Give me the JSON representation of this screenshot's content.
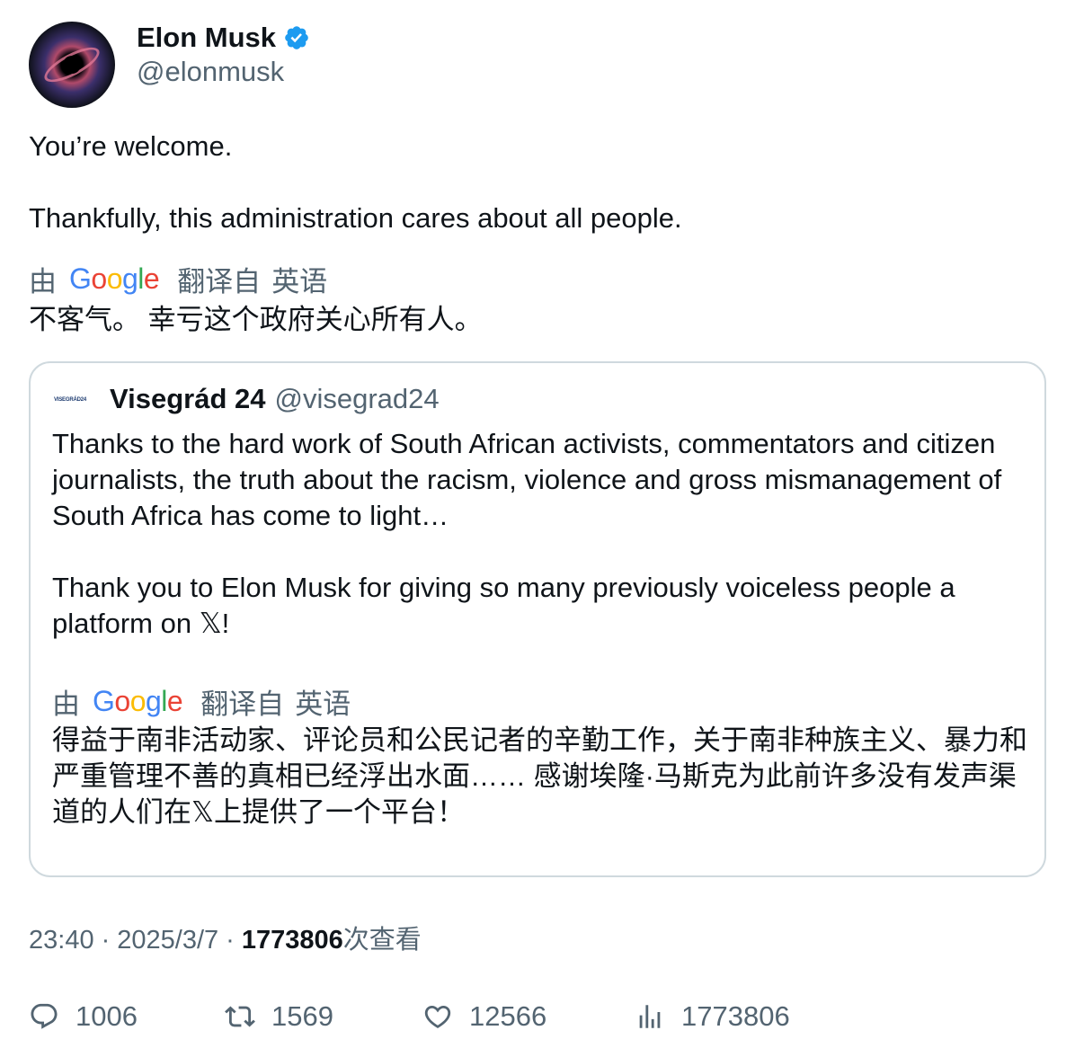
{
  "author": {
    "name": "Elon Musk",
    "handle": "@elonmusk",
    "verified": true,
    "avatar_icon": "black-hole-avatar"
  },
  "tweet": {
    "line1": "You’re welcome.",
    "line2": "Thankfully, this administration cares about all people."
  },
  "translation": {
    "by": "由",
    "google_letters": [
      "G",
      "o",
      "o",
      "g",
      "l",
      "e"
    ],
    "from": "翻译自",
    "language": "英语",
    "text": "不客气。 幸亏这个政府关心所有人。"
  },
  "quoted": {
    "avatar_text": "VISEGRÁD24",
    "name": "Visegrád 24",
    "handle": "@visegrad24",
    "para1": "Thanks to the hard work of South African activists, commentators and citizen journalists, the truth about the racism, violence and gross mismanagement of South Africa has come to light…",
    "para2": "Thank you to Elon Musk for giving so many previously voiceless people a platform on 𝕏!",
    "translation": {
      "by": "由",
      "from": "翻译自",
      "language": "英语",
      "text": "得益于南非活动家、评论员和公民记者的辛勤工作，关于南非种族主义、暴力和严重管理不善的真相已经浮出水面…… 感谢埃隆·马斯克为此前许多没有发声渠道的人们在𝕏上提供了一个平台！"
    }
  },
  "meta": {
    "time": "23:40",
    "date": "2025/3/7",
    "dot": "·",
    "views": "1773806",
    "views_label": "次查看"
  },
  "actions": {
    "replies": "1006",
    "reposts": "1569",
    "likes": "12566",
    "views": "1773806"
  },
  "colors": {
    "text": "#0f1419",
    "secondary": "#536471",
    "border": "#cfd9de",
    "verified": "#1d9bf0"
  }
}
